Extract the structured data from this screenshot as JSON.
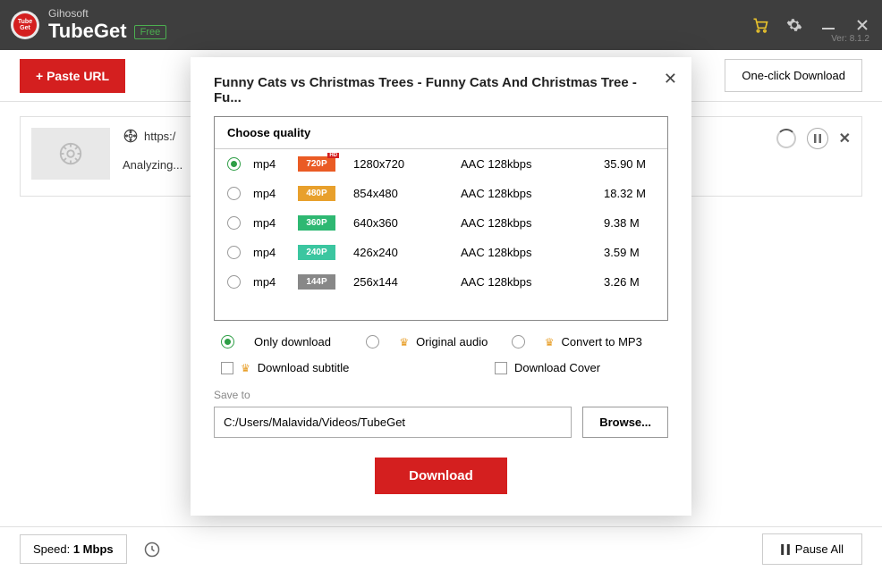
{
  "titlebar": {
    "brand_top": "Gihosoft",
    "brand_name": "TubeGet",
    "free_label": "Free",
    "version": "Ver: 8.1.2"
  },
  "toolbar": {
    "paste_label": "+ Paste URL",
    "oneclick_label": "One-click Download"
  },
  "item": {
    "url_prefix": "https:/",
    "status": "Analyzing..."
  },
  "footer": {
    "speed_label": "Speed:",
    "speed_value": "1 Mbps",
    "pauseall_label": "Pause All"
  },
  "modal": {
    "title": "Funny Cats vs Christmas Trees - Funny Cats And Christmas Tree - Fu...",
    "choose_quality": "Choose quality",
    "qualities": [
      {
        "format": "mp4",
        "res": "720P",
        "badge": "b720",
        "hd": true,
        "dim": "1280x720",
        "audio": "AAC 128kbps",
        "size": "35.90 M",
        "selected": true
      },
      {
        "format": "mp4",
        "res": "480P",
        "badge": "b480",
        "hd": false,
        "dim": "854x480",
        "audio": "AAC 128kbps",
        "size": "18.32 M",
        "selected": false
      },
      {
        "format": "mp4",
        "res": "360P",
        "badge": "b360",
        "hd": false,
        "dim": "640x360",
        "audio": "AAC 128kbps",
        "size": "9.38 M",
        "selected": false
      },
      {
        "format": "mp4",
        "res": "240P",
        "badge": "b240",
        "hd": false,
        "dim": "426x240",
        "audio": "AAC 128kbps",
        "size": "3.59 M",
        "selected": false
      },
      {
        "format": "mp4",
        "res": "144P",
        "badge": "b144",
        "hd": false,
        "dim": "256x144",
        "audio": "AAC 128kbps",
        "size": "3.26 M",
        "selected": false
      }
    ],
    "opts": {
      "only_download": "Only download",
      "original_audio": "Original audio",
      "convert_mp3": "Convert to MP3",
      "download_subtitle": "Download subtitle",
      "download_cover": "Download Cover"
    },
    "saveto_label": "Save to",
    "saveto_path": "C:/Users/Malavida/Videos/TubeGet",
    "browse_label": "Browse...",
    "download_label": "Download"
  }
}
